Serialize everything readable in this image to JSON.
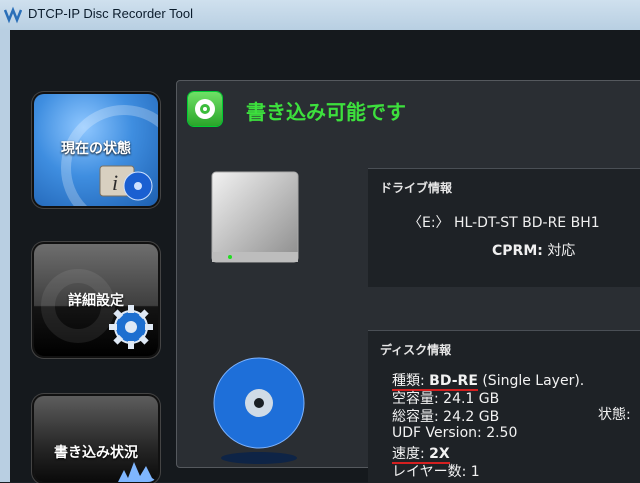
{
  "window": {
    "title": "DTCP-IP Disc Recorder Tool"
  },
  "nav": {
    "status_label": "現在の状態",
    "detail_label": "詳細設定",
    "progress_label": "書き込み状況"
  },
  "status": {
    "message": "書き込み可能です"
  },
  "drive_info": {
    "header": "ドライブ情報",
    "name": "〈E:〉 HL-DT-ST BD-RE  BH1",
    "cprm_key": "CPRM:",
    "cprm_value": "対応"
  },
  "disc_info": {
    "header": "ディスク情報",
    "type_key": "種類:",
    "type_value": "BD-RE",
    "type_extra": "(Single Layer).",
    "free_key": "空容量:",
    "free_value": "24.1 GB",
    "total_key": "総容量:",
    "total_value": "24.2 GB",
    "state_key": "状態:",
    "udf_key": "UDF Version:",
    "udf_value": "2.50",
    "speed_key": "速度:",
    "speed_value": "2X",
    "layers_key": "レイヤー数:",
    "layers_value": "1"
  },
  "colors": {
    "status_green": "#3de03d",
    "underline_red": "#d42020",
    "accent_blue": "#3f8ee0"
  }
}
